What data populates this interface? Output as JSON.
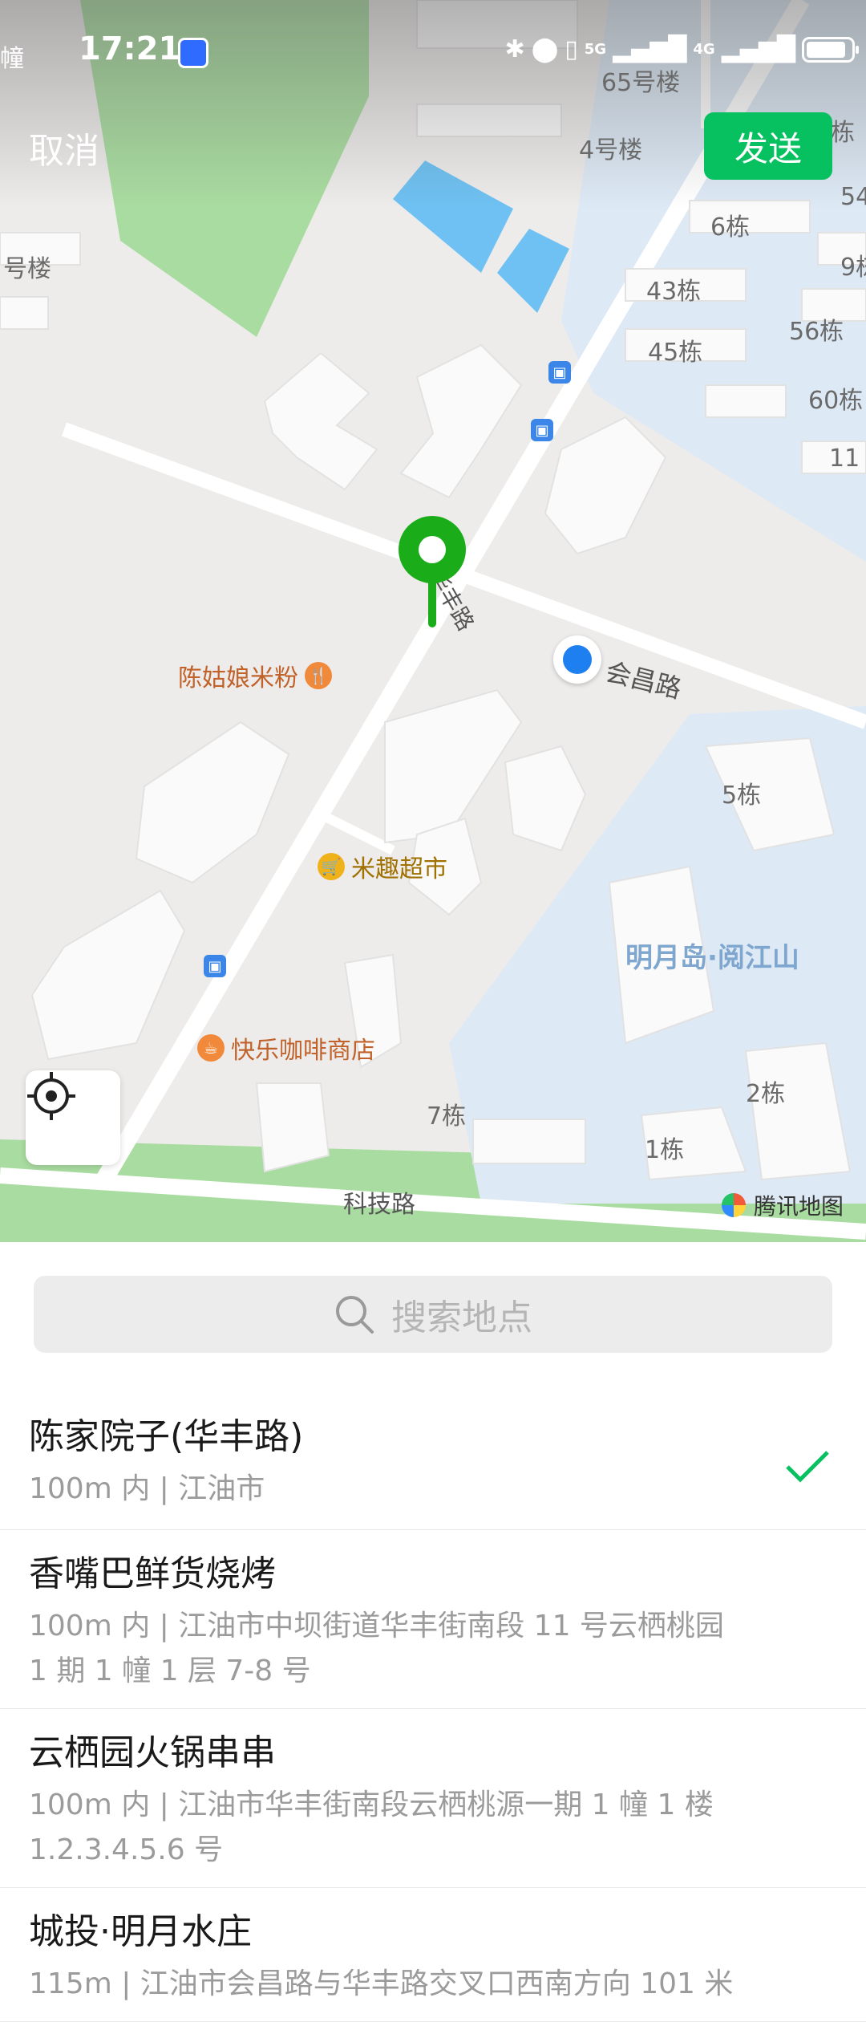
{
  "status_bar": {
    "left_clip": "幢",
    "time": "17:21",
    "network_5g": "5G",
    "network_4g": "4G"
  },
  "header": {
    "cancel_label": "取消",
    "send_label": "发送"
  },
  "map": {
    "building_labels": [
      "65号楼",
      "4号楼",
      "栋",
      "54",
      "6栋",
      "9栋",
      "号楼",
      "43栋",
      "56栋",
      "45栋",
      "60栋",
      "11",
      "5栋",
      "2栋",
      "1栋",
      "7栋"
    ],
    "road_labels": {
      "huafeng": "华丰路",
      "huichang": "会昌路",
      "keji": "科技路"
    },
    "district_label": "明月岛·阅江山",
    "pois": {
      "rice_noodle": "陈姑娘米粉",
      "supermarket": "米趣超市",
      "cafe": "快乐咖啡商店"
    },
    "attribution": "腾讯地图"
  },
  "search": {
    "placeholder": "搜索地点"
  },
  "places": [
    {
      "name": "陈家院子(华丰路)",
      "detail": "100m 内 | 江油市",
      "selected": true
    },
    {
      "name": "香嘴巴鲜货烧烤",
      "detail": "100m 内 | 江油市中坝街道华丰街南段 11 号云栖桃园 1 期 1 幢 1 层 7-8 号",
      "selected": false
    },
    {
      "name": "云栖园火锅串串",
      "detail": "100m 内 | 江油市华丰街南段云栖桃源一期 1 幢 1 楼 1.2.3.4.5.6 号",
      "selected": false
    },
    {
      "name": "城投·明月水庄",
      "detail": "115m | 江油市会昌路与华丰路交叉口西南方向 101 米",
      "selected": false
    }
  ],
  "colors": {
    "accent_green": "#07c160",
    "pin_green": "#1aad19",
    "user_location_blue": "#1e7ff0",
    "water_blue": "#6ec1f2"
  }
}
